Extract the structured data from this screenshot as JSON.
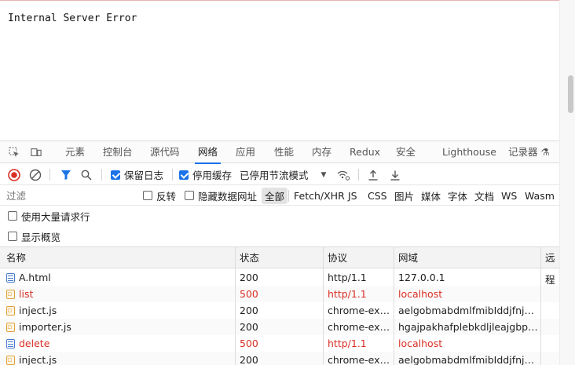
{
  "page": {
    "error_text": "Internal Server Error"
  },
  "devtools": {
    "tabs": [
      "元素",
      "控制台",
      "源代码",
      "网络",
      "应用",
      "性能",
      "内存",
      "Redux",
      "安全",
      "Lighthouse",
      "记录器 ⚗"
    ],
    "active_tab": "网络",
    "toolbar": {
      "preserve_log": "保留日志",
      "disable_cache": "停用缓存",
      "throttle": "已停用节流模式"
    },
    "filter": {
      "placeholder": "过滤",
      "invert": "反转",
      "hide_data_urls": "隐藏数据网址",
      "types": [
        "全部",
        "Fetch/XHR",
        "JS",
        "CSS",
        "图片",
        "媒体",
        "字体",
        "文档",
        "WS",
        "Wasm"
      ],
      "active_type": "全部"
    },
    "options": {
      "large_rows": "使用大量请求行",
      "overview": "显示概览"
    },
    "table": {
      "headers": {
        "name": "名称",
        "status": "状态",
        "protocol": "协议",
        "domain": "网域",
        "remote": "远程"
      },
      "rows": [
        {
          "name": "A.html",
          "type": "doc",
          "status": "200",
          "protocol": "http/1.1",
          "domain": "127.0.0.1",
          "error": false
        },
        {
          "name": "list",
          "type": "js",
          "status": "500",
          "protocol": "http/1.1",
          "domain": "localhost",
          "error": true
        },
        {
          "name": "inject.js",
          "type": "js",
          "status": "200",
          "protocol": "chrome-ext…",
          "domain": "aelgobmabdmlfmibIddjfnjodal…",
          "error": false
        },
        {
          "name": "importer.js",
          "type": "js",
          "status": "200",
          "protocol": "chrome-ext…",
          "domain": "hgajpakhafplebkdljleajgbpdmp…",
          "error": false
        },
        {
          "name": "delete",
          "type": "doc",
          "status": "500",
          "protocol": "http/1.1",
          "domain": "localhost",
          "error": true
        },
        {
          "name": "inject.js",
          "type": "js",
          "status": "200",
          "protocol": "chrome-ext…",
          "domain": "aelgobmabdmlfmibIddjfnjodal…",
          "error": false
        }
      ]
    }
  },
  "colors": {
    "accent": "#1a73e8",
    "error": "#d93025",
    "record": "#d93025"
  }
}
